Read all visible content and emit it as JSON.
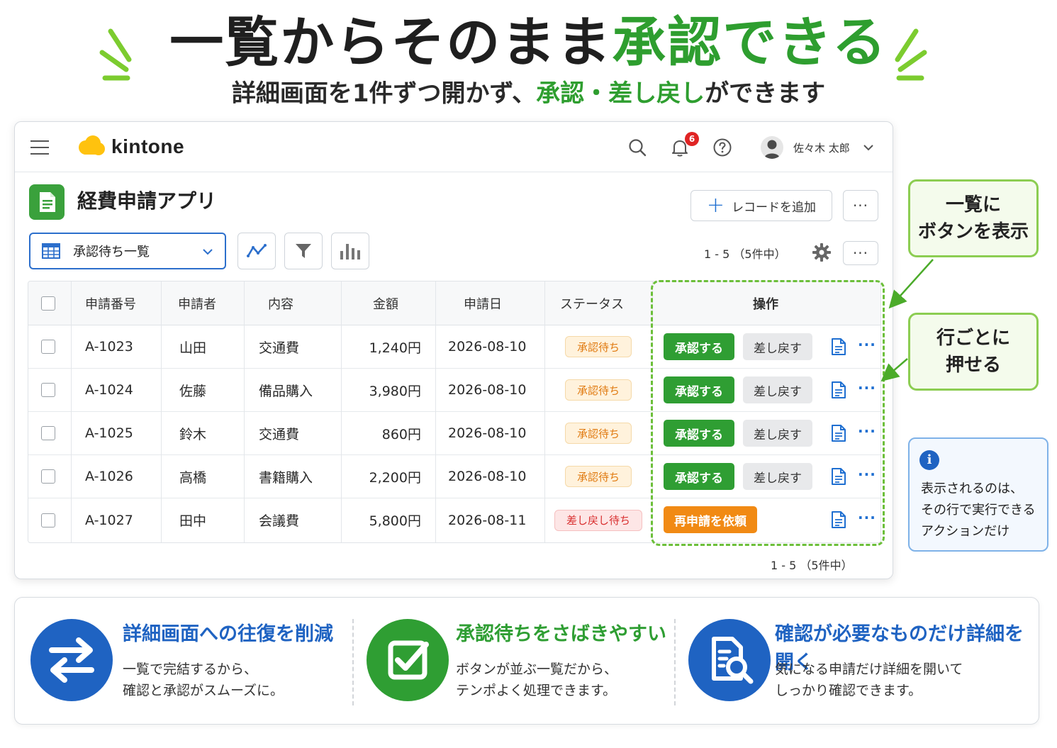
{
  "headline": {
    "main": "一覧からそのまま",
    "accent": "承認できる"
  },
  "subline": {
    "pre": "詳細画面を1件ずつ開かず、",
    "accent": "承認・差し戻し",
    "post": "ができます"
  },
  "app": {
    "logo": "kintone",
    "notification_count": "6",
    "user_name": "佐々木 太郎",
    "title": "経費申請アプリ",
    "add_record": "レコードを追加",
    "more": "···",
    "view_name": "承認待ち一覧",
    "count_top": "1 - 5 （5件中）",
    "count_bottom": "1 - 5 （5件中）"
  },
  "table": {
    "headers": [
      "申請番号",
      "申請者",
      "内容",
      "金額",
      "申請日",
      "ステータス",
      "操作"
    ],
    "rows": [
      {
        "id": "A-1023",
        "applicant": "山田",
        "content": "交通費",
        "amount": "1,240円",
        "date": "2026-08-10",
        "status": "承認待ち"
      },
      {
        "id": "A-1024",
        "applicant": "佐藤",
        "content": "備品購入",
        "amount": "3,980円",
        "date": "2026-08-10",
        "status": "承認待ち"
      },
      {
        "id": "A-1025",
        "applicant": "鈴木",
        "content": "交通費",
        "amount": "860円",
        "date": "2026-08-10",
        "status": "承認待ち"
      },
      {
        "id": "A-1026",
        "applicant": "高橋",
        "content": "書籍購入",
        "amount": "2,200円",
        "date": "2026-08-10",
        "status": "承認待ち"
      },
      {
        "id": "A-1027",
        "applicant": "田中",
        "content": "会議費",
        "amount": "5,800円",
        "date": "2026-08-11",
        "status": "差し戻し待ち"
      }
    ],
    "actions": {
      "approve": "承認する",
      "return": "差し戻す",
      "reapply": "再申請を依頼",
      "more": "···"
    }
  },
  "callouts": {
    "list_buttons": [
      "一覧に",
      "ボタンを表示"
    ],
    "per_row": [
      "行ごとに",
      "押せる"
    ],
    "info": [
      "表示されるのは、",
      "その行で実行できる",
      "アクションだけ"
    ]
  },
  "features": [
    {
      "title": "詳細画面への往復を削減",
      "desc": [
        "一覧で完結するから、",
        "確認と承認がスムーズに。"
      ],
      "color": "#1f63c2",
      "icon": "swap-arrows-icon"
    },
    {
      "title": "承認待ちをさばきやすい",
      "desc": [
        "ボタンが並ぶ一覧だから、",
        "テンポよく処理できます。"
      ],
      "color": "#2f9e33",
      "icon": "checkbox-icon"
    },
    {
      "title": "確認が必要なものだけ詳細を開く",
      "desc": [
        "気になる申請だけ詳細を開いて",
        "しっかり確認できます。"
      ],
      "color": "#1f63c2",
      "icon": "document-search-icon"
    }
  ],
  "colors": {
    "green": "#2f9e33",
    "blue": "#1f63c2",
    "orange": "#f18a14",
    "highlight": "#6cbf3a"
  },
  "icons": [
    "hamburger-icon",
    "search-icon",
    "bell-icon",
    "help-icon",
    "user-avatar-icon",
    "chevron-down-icon",
    "table-grid-icon",
    "graph-icon",
    "filter-icon",
    "bar-chart-icon",
    "gear-icon",
    "document-icon",
    "info-icon"
  ]
}
